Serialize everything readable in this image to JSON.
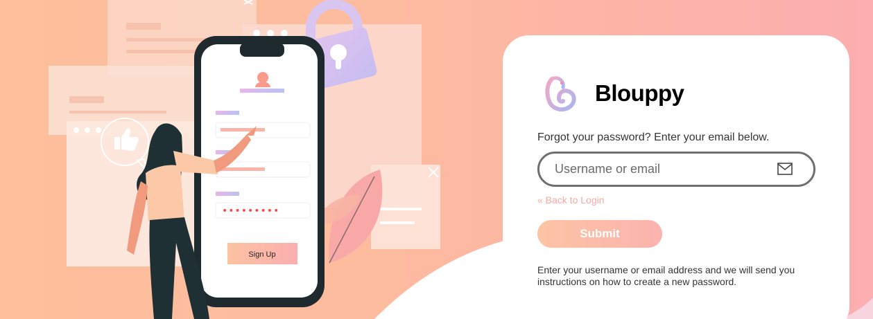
{
  "brand": {
    "name": "Blouppy",
    "logo_icon": "b-heart-logo-icon"
  },
  "illustration": {
    "phone_button_label": "Sign Up",
    "password_dots": "•••••••••"
  },
  "form": {
    "prompt": "Forgot your password? Enter your email below.",
    "email_placeholder": "Username or email",
    "email_value": "",
    "field_icon": "mail-icon",
    "back_link": "« Back to Login",
    "submit_label": "Submit",
    "help_text": "Enter your username or email address and we will send you instructions on how to create a new password."
  },
  "colors": {
    "accent_peach": "#fdbf9c",
    "accent_pink": "#fcaeb0",
    "link": "#f7a8a2"
  }
}
